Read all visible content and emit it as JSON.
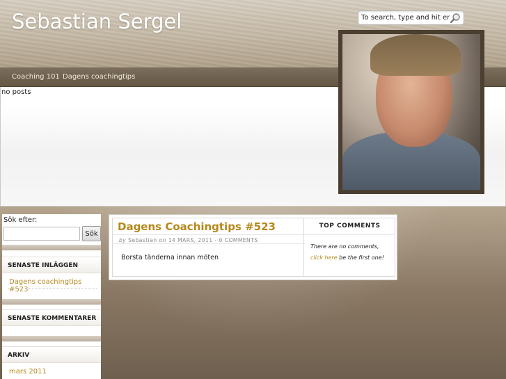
{
  "header": {
    "site_title": "Sebastian Sergel",
    "search_placeholder": "To search, type and hit enter",
    "search_icon": "magnifier-icon"
  },
  "nav": {
    "items": [
      {
        "label": "Coaching 101"
      },
      {
        "label": "Dagens coachingtips"
      }
    ]
  },
  "featured": {
    "empty_text": "no posts",
    "photo": "portrait-photo"
  },
  "sidebar": {
    "search_label": "Sök efter:",
    "search_button": "Sök",
    "widgets": [
      {
        "title": "SENASTE INLÄGGEN",
        "links": [
          "Dagens coachingtips #523"
        ]
      },
      {
        "title": "SENASTE KOMMENTARER",
        "links": []
      },
      {
        "title": "ARKIV",
        "links": [
          "mars 2011"
        ]
      }
    ]
  },
  "post": {
    "title": "Dagens Coachingtips #523",
    "meta_by": "by",
    "author": "Sebastian",
    "meta_on": "on",
    "date_and_comments": "14 MARS, 2011 - 0 COMMENTS",
    "body": "Borsta tänderna innan möten"
  },
  "top_comments": {
    "title": "TOP COMMENTS",
    "none_text": "There are no comments,",
    "link_text": "click here",
    "suffix": "be the first one!"
  },
  "colors": {
    "accent_gold": "#b5881a",
    "nav_bar": "#6f6150",
    "header_bg": "#c9bca9"
  }
}
